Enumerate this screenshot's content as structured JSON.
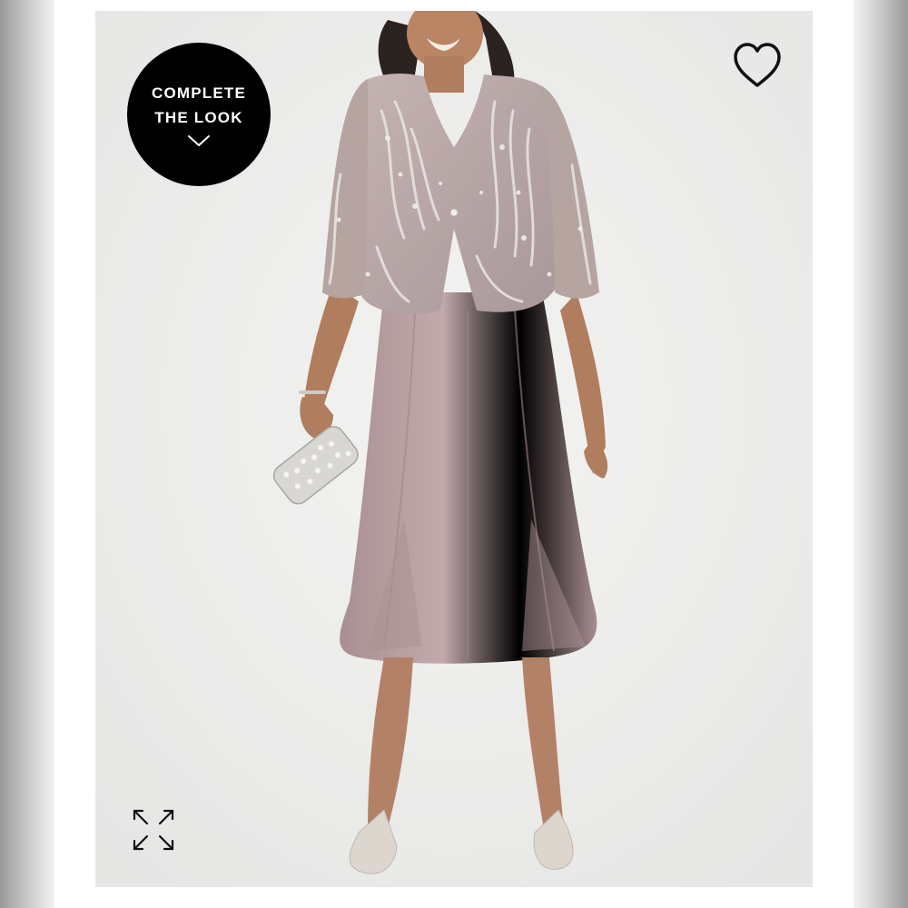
{
  "complete_look": {
    "line1": "COMPLETE",
    "line2": "THE LOOK",
    "icon": "chevron-down-icon"
  },
  "actions": {
    "favorite_icon": "heart-icon",
    "expand_icon": "expand-icon"
  },
  "colors": {
    "badge_background": "#000000",
    "badge_text": "#ffffff",
    "image_background": "#ececeb",
    "dress": "#b9a0a1",
    "jacket": "#b8a7a4"
  }
}
